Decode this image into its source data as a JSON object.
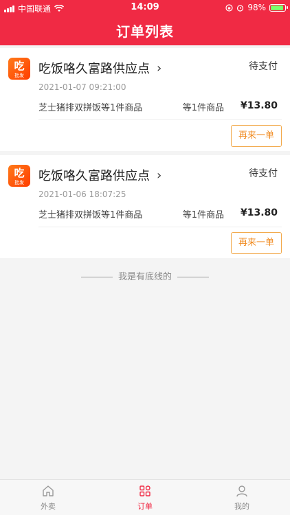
{
  "status_bar": {
    "carrier": "中国联通",
    "time": "14:09",
    "battery": "98%"
  },
  "header": {
    "title": "订单列表"
  },
  "orders": [
    {
      "shop": "吃饭咯久富路供应点",
      "status": "待支付",
      "time": "2021-01-07 09:21:00",
      "goods": "芝士猪排双拼饭等1件商品",
      "count": "等1件商品",
      "price": "¥13.80",
      "reorder_label": "再来一单",
      "logo_main": "吃",
      "logo_sub": "批发"
    },
    {
      "shop": "吃饭咯久富路供应点",
      "status": "待支付",
      "time": "2021-01-06 18:07:25",
      "goods": "芝士猪排双拼饭等1件商品",
      "count": "等1件商品",
      "price": "¥13.80",
      "reorder_label": "再来一单",
      "logo_main": "吃",
      "logo_sub": "批发"
    }
  ],
  "bottom_text": "我是有底线的",
  "tabs": [
    {
      "label": "外卖",
      "icon": "home-icon"
    },
    {
      "label": "订单",
      "icon": "grid-icon"
    },
    {
      "label": "我的",
      "icon": "user-icon"
    }
  ],
  "colors": {
    "brand": "#f02a44",
    "accent": "#f08a1e"
  }
}
